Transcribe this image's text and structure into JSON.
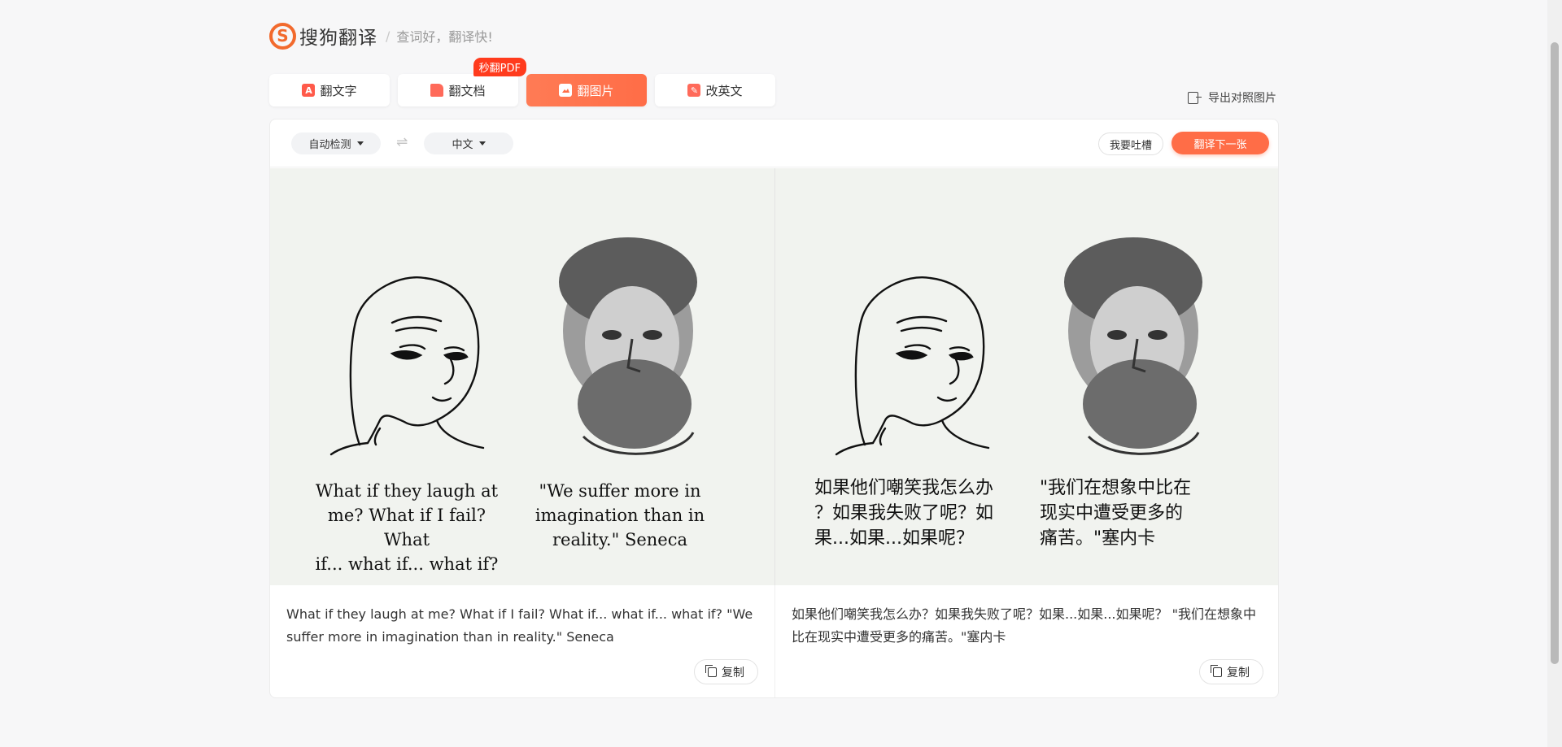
{
  "header": {
    "logo_mark": "S",
    "logo_text": "搜狗翻译",
    "separator": "/",
    "slogan": "查词好，翻译快!"
  },
  "tabs": [
    {
      "label": "翻文字",
      "icon": "text-translate-icon"
    },
    {
      "label": "翻文档",
      "icon": "document-icon",
      "badge": "秒翻PDF"
    },
    {
      "label": "翻图片",
      "icon": "image-icon",
      "active": true
    },
    {
      "label": "改英文",
      "icon": "edit-english-icon"
    }
  ],
  "export": {
    "label": "导出对照图片",
    "icon": "export-icon"
  },
  "toolbar": {
    "source_lang": "自动检测",
    "swap_icon": "⇌",
    "target_lang": "中文",
    "feedback": "我要吐槽",
    "next": "翻译下一张"
  },
  "images": {
    "original": {
      "left_caption": [
        "What if they laugh at",
        "me? What if I fail? What",
        "if... what if... what if?"
      ],
      "right_caption": [
        "\"We suffer more in",
        "imagination than in",
        "reality.\" Seneca"
      ]
    },
    "translated": {
      "left_caption": [
        "如果他们嘲笑我怎么办",
        "？如果我失败了呢？如",
        "果...如果...如果呢？"
      ],
      "right_caption": [
        "\"我们在想象中比在",
        "现实中遭受更多的",
        "痛苦。\"塞内卡"
      ]
    }
  },
  "result": {
    "source_text": "What if they laugh at me? What if I fail? What if... what if... what if? \"We suffer more in imagination than in reality.\" Seneca",
    "target_text": "如果他们嘲笑我怎么办？如果我失败了呢？如果...如果...如果呢？ \"我们在想象中比在现实中遭受更多的痛苦。\"塞内卡",
    "copy_label": "复制"
  },
  "colors": {
    "accent": "#ff6d47",
    "logo": "#f26a2d",
    "badge": "#ff3b1d",
    "image_bg": "#f1f3ef"
  }
}
